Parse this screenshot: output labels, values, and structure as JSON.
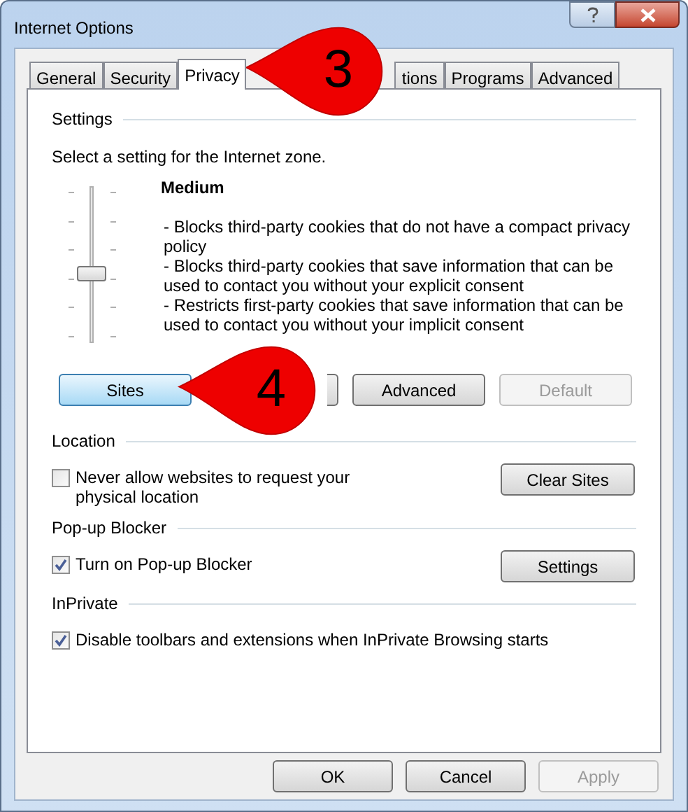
{
  "window": {
    "title": "Internet Options"
  },
  "tabs": [
    {
      "label": "General",
      "selected": false
    },
    {
      "label": "Security",
      "selected": false
    },
    {
      "label": "Privacy",
      "selected": true
    },
    {
      "kind": "covered"
    },
    {
      "label": "tions",
      "selected": false
    },
    {
      "label": "Programs",
      "selected": false
    },
    {
      "label": "Advanced",
      "selected": false
    }
  ],
  "settings": {
    "heading": "Settings",
    "prompt": "Select a setting for the Internet zone.",
    "slider": {
      "level": 0.4
    },
    "level_name": "Medium",
    "description": [
      "- Blocks third-party cookies that do not have a compact privacy policy",
      "- Blocks third-party cookies that save information that can be used to contact you without your explicit consent",
      "- Restricts first-party cookies that save information that can be used to contact you without your implicit consent"
    ],
    "buttons": [
      {
        "kind": "button",
        "label": "Sites",
        "disabled": false,
        "focused": true
      },
      {
        "kind": "covered"
      },
      {
        "kind": "button",
        "label": "Advanced",
        "disabled": false,
        "focused": false
      },
      {
        "kind": "button",
        "label": "Default",
        "disabled": true,
        "focused": false
      }
    ]
  },
  "sections": [
    {
      "heading": "Location",
      "checkbox": {
        "label": "Never allow websites to request your physical location",
        "checked": false
      },
      "button": "Clear Sites"
    },
    {
      "heading": "Pop-up Blocker",
      "checkbox": {
        "label": "Turn on Pop-up Blocker",
        "checked": true
      },
      "button": "Settings"
    },
    {
      "heading": "InPrivate",
      "checkbox": {
        "label": "Disable toolbars and extensions when InPrivate Browsing starts",
        "checked": true
      }
    }
  ],
  "footer_buttons": [
    {
      "label": "OK",
      "disabled": false
    },
    {
      "label": "Cancel",
      "disabled": false
    },
    {
      "label": "Apply",
      "disabled": true
    }
  ],
  "callouts": [
    {
      "label": "3"
    },
    {
      "label": "4"
    }
  ]
}
